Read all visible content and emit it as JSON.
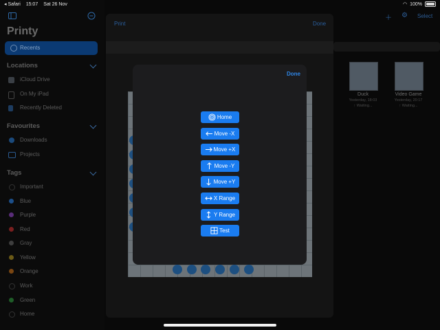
{
  "status_bar": {
    "back_app": "◂ Safari",
    "time": "15:07",
    "date": "Sat 26 Nov",
    "battery": "100%"
  },
  "sidebar": {
    "title": "Printy",
    "recents": "Recents",
    "locations_header": "Locations",
    "locations": [
      "iCloud Drive",
      "On My iPad",
      "Recently Deleted"
    ],
    "favourites_header": "Favourites",
    "favourites": [
      "Downloads",
      "Projects"
    ],
    "tags_header": "Tags",
    "tags": [
      {
        "label": "Important",
        "color": "#1a1a1a"
      },
      {
        "label": "Blue",
        "color": "#1c4f8a"
      },
      {
        "label": "Purple",
        "color": "#5a2d7a"
      },
      {
        "label": "Red",
        "color": "#7a1f1f"
      },
      {
        "label": "Gray",
        "color": "#3e3e3e"
      },
      {
        "label": "Yellow",
        "color": "#6b5a16"
      },
      {
        "label": "Orange",
        "color": "#7a4612"
      },
      {
        "label": "Work",
        "color": "#1a1a1a"
      },
      {
        "label": "Green",
        "color": "#1f5d28"
      },
      {
        "label": "Home",
        "color": "#1a1a1a"
      }
    ]
  },
  "browser": {
    "select_label": "Select",
    "files": [
      {
        "name": "Duck",
        "date": "Yesterday, 18:03",
        "status": "↑ Waiting..."
      },
      {
        "name": "Video Game",
        "date": "Yesterday, 20:17",
        "status": "↑ Waiting..."
      }
    ]
  },
  "print_sheet": {
    "print_label": "Print",
    "done_label": "Done"
  },
  "modal": {
    "done_label": "Done",
    "commands": [
      {
        "label": "Home",
        "icon": "home-target-icon"
      },
      {
        "label": "Move -X",
        "icon": "arrow-left-icon"
      },
      {
        "label": "Move +X",
        "icon": "arrow-right-icon"
      },
      {
        "label": "Move -Y",
        "icon": "arrow-up-icon"
      },
      {
        "label": "Move +Y",
        "icon": "arrow-down-icon"
      },
      {
        "label": "X Range",
        "icon": "arrow-left-right-icon"
      },
      {
        "label": "Y Range",
        "icon": "arrow-up-down-icon"
      },
      {
        "label": "Test",
        "icon": "grid-icon"
      }
    ]
  },
  "colors": {
    "accent": "#1a7cf0",
    "modal_bg": "#1c1c1e"
  }
}
